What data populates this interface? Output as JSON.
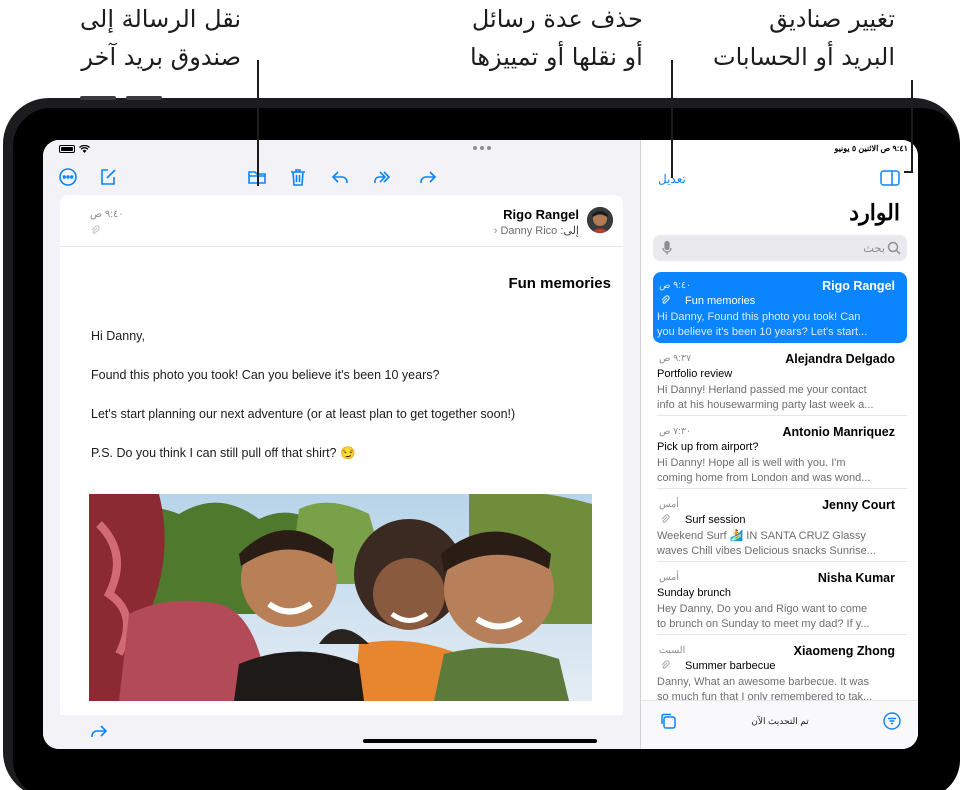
{
  "callouts": {
    "move_message": [
      "نقل الرسالة إلى",
      "صندوق بريد آخر"
    ],
    "delete_multiple": [
      "حذف عدة رسائل",
      "أو نقلها أو تمييزها"
    ],
    "change_mailboxes": [
      "تغيير صناديق",
      "البريد أو الحسابات"
    ]
  },
  "status_bar": {
    "time_date": "٩:٤١ ص   الاثنين ٥ يونيو"
  },
  "list_pane": {
    "edit_label": "تعديل",
    "title": "الوارد",
    "search_placeholder": "بحث",
    "updated_label": "تم التحديث الآن",
    "messages": [
      {
        "sender": "Rigo Rangel",
        "time": "٩:٤٠ ص",
        "subject": "Fun memories",
        "has_attachment": true,
        "preview": [
          "Hi Danny, Found this photo you took! Can",
          "you believe it's been 10 years? Let's start..."
        ],
        "selected": true
      },
      {
        "sender": "Alejandra Delgado",
        "time": "٩:٣٧ ص",
        "subject": "Portfolio review",
        "has_attachment": false,
        "preview": [
          "Hi Danny! Herland passed me your contact",
          "info at his housewarming party last week a..."
        ],
        "selected": false
      },
      {
        "sender": "Antonio Manriquez",
        "time": "٧:٣٠ ص",
        "subject": "Pick up from airport?",
        "has_attachment": false,
        "preview": [
          "Hi Danny! Hope all is well with you. I'm",
          "coming home from London and was wond..."
        ],
        "selected": false
      },
      {
        "sender": "Jenny Court",
        "time": "أمس",
        "subject": "Surf session",
        "has_attachment": true,
        "preview": [
          "Weekend Surf 🏄 IN SANTA CRUZ Glassy",
          "waves Chill vibes Delicious snacks Sunrise..."
        ],
        "selected": false
      },
      {
        "sender": "Nisha Kumar",
        "time": "أمس",
        "subject": "Sunday brunch",
        "has_attachment": false,
        "preview": [
          "Hey Danny, Do you and Rigo want to come",
          "to brunch on Sunday to meet my dad? If y..."
        ],
        "selected": false
      },
      {
        "sender": "Xiaomeng Zhong",
        "time": "السبت",
        "subject": "Summer barbecue",
        "has_attachment": true,
        "preview": [
          "Danny, What an awesome barbecue. It was",
          "so much fun that I only remembered to tak..."
        ],
        "selected": false
      }
    ]
  },
  "detail": {
    "sender": "Rigo Rangel",
    "to_prefix": "إلى:",
    "to_name": "Danny Rico",
    "time": "٩:٤٠ ص",
    "subject": "Fun memories",
    "body": [
      "Hi Danny,",
      "Found this photo you took! Can you believe it's been 10 years?",
      "Let's start planning our next adventure (or at least plan to get together soon!)",
      "P.S. Do you think I can still pull off that shirt? 😏"
    ]
  },
  "icons": {
    "accent": "#0a84ff"
  }
}
